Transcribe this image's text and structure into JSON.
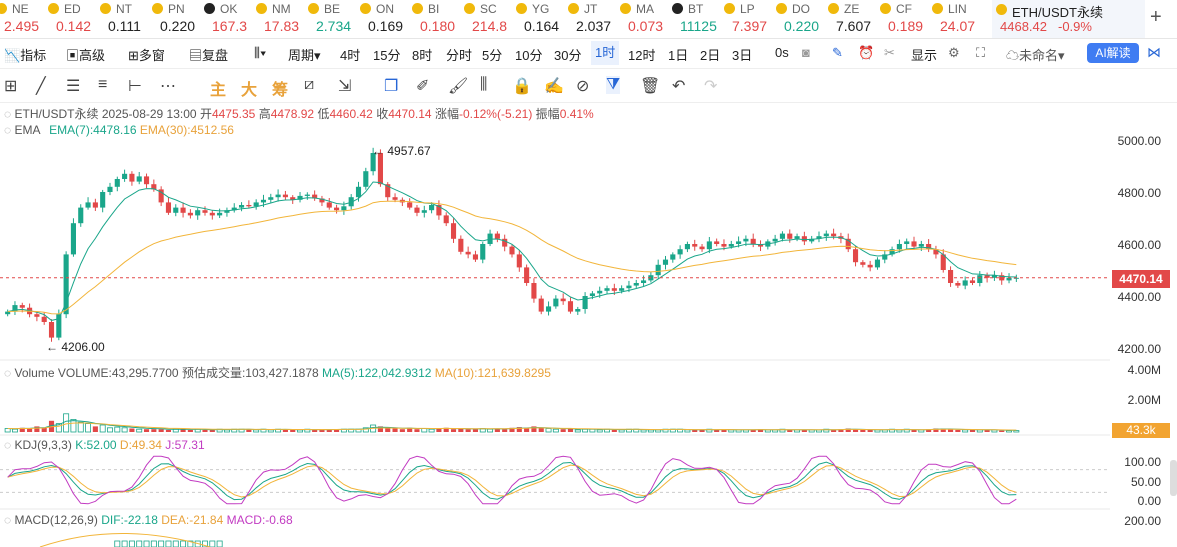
{
  "ticker": [
    {
      "name": "NE",
      "price": "2.495",
      "color": "dn"
    },
    {
      "name": "ED",
      "price": "0.142",
      "color": "dn"
    },
    {
      "name": "NT",
      "price": "0.111",
      "color": "nt"
    },
    {
      "name": "PN",
      "price": "0.220",
      "color": "nt"
    },
    {
      "name": "OK",
      "price": "167.3",
      "color": "dn"
    },
    {
      "name": "NM",
      "price": "17.83",
      "color": "dn"
    },
    {
      "name": "BE",
      "price": "2.734",
      "color": "up"
    },
    {
      "name": "ON",
      "price": "0.169",
      "color": "nt"
    },
    {
      "name": "BI",
      "price": "0.180",
      "color": "dn"
    },
    {
      "name": "SC",
      "price": "214.8",
      "color": "dn"
    },
    {
      "name": "YG",
      "price": "0.164",
      "color": "nt"
    },
    {
      "name": "JT",
      "price": "2.037",
      "color": "nt"
    },
    {
      "name": "MA",
      "price": "0.073",
      "color": "dn"
    },
    {
      "name": "BT",
      "price": "11125",
      "color": "up"
    },
    {
      "name": "LP",
      "price": "7.397",
      "color": "dn"
    },
    {
      "name": "DO",
      "price": "0.220",
      "color": "up"
    },
    {
      "name": "ZE",
      "price": "7.607",
      "color": "nt"
    },
    {
      "name": "CF",
      "price": "0.189",
      "color": "dn"
    },
    {
      "name": "LIN",
      "price": "24.07",
      "color": "dn"
    }
  ],
  "active_tab": {
    "name": "ETH/USDT永续",
    "price": "4468.42",
    "change": "-0.9%"
  },
  "toolbar": {
    "indicators": "指标",
    "advanced": "高级",
    "multi_window": "多窗",
    "replay": "复盘",
    "period": "周期",
    "intervals": [
      "4时",
      "15分",
      "8时",
      "分时",
      "5分",
      "10分",
      "30分",
      "1时",
      "12时",
      "1日",
      "2日",
      "3日"
    ],
    "selected_interval": "1时",
    "seconds": "0s",
    "display": "显示",
    "unnamed": "未命名",
    "ai": "AI解读"
  },
  "draw_tools": {
    "zhu": "主",
    "da": "大",
    "chou": "筹"
  },
  "info": {
    "symbol": "ETH/USDT永续",
    "date": "2025-08-29 13:00",
    "open_label": "开",
    "open": "4475.35",
    "high_label": "高",
    "high": "4478.92",
    "low_label": "低",
    "low": "4460.42",
    "close_label": "收",
    "close": "4470.14",
    "change_label": "涨幅",
    "change": "-0.12%(-5.21)",
    "amp_label": "振幅",
    "amp": "0.41%"
  },
  "ema": {
    "label": "EMA",
    "ema7": "EMA(7):4478.16",
    "ema30": "EMA(30):4512.56"
  },
  "volume": {
    "label": "Volume",
    "vol": "VOLUME:43,295.7700",
    "est": "预估成交量:103,427.1878",
    "ma5": "MA(5):122,042.9312",
    "ma10": "MA(10):121,639.8295",
    "tag": "43.3k",
    "axis": [
      "4.00M",
      "2.00M"
    ]
  },
  "kdj": {
    "label": "KDJ(9,3,3)",
    "k": "K:52.00",
    "d": "D:49.34",
    "j": "J:57.31",
    "axis": [
      "100.00",
      "50.00",
      "0.00"
    ]
  },
  "macd": {
    "label": "MACD(12,26,9)",
    "dif": "DIF:-22.18",
    "dea": "DEA:-21.84",
    "macd": "MACD:-0.68",
    "axis": [
      "200.00"
    ]
  },
  "price_axis": [
    "5000.00",
    "4800.00",
    "4600.00",
    "4400.00",
    "4200.00"
  ],
  "current_price": "4470.14",
  "marks": {
    "high": "4957.67",
    "low": "4206.00"
  },
  "chart_data": {
    "type": "candlestick",
    "symbol": "ETH/USDT永续",
    "interval": "1时",
    "ylim": [
      4200,
      5000
    ],
    "last": {
      "open": 4475.35,
      "high": 4478.92,
      "low": 4460.42,
      "close": 4470.14
    },
    "max": 4957.67,
    "min": 4206.0,
    "closes": [
      4340,
      4365,
      4355,
      4330,
      4320,
      4300,
      4240,
      4330,
      4560,
      4680,
      4740,
      4760,
      4740,
      4800,
      4820,
      4850,
      4870,
      4840,
      4860,
      4830,
      4810,
      4760,
      4720,
      4740,
      4720,
      4710,
      4730,
      4720,
      4710,
      4720,
      4730,
      4740,
      4750,
      4745,
      4760,
      4770,
      4780,
      4790,
      4780,
      4770,
      4785,
      4790,
      4775,
      4760,
      4740,
      4730,
      4745,
      4780,
      4820,
      4880,
      4950,
      4830,
      4780,
      4770,
      4760,
      4740,
      4720,
      4730,
      4750,
      4710,
      4680,
      4620,
      4570,
      4560,
      4540,
      4600,
      4640,
      4620,
      4590,
      4560,
      4510,
      4450,
      4390,
      4340,
      4360,
      4390,
      4380,
      4340,
      4350,
      4400,
      4410,
      4420,
      4430,
      4420,
      4430,
      4440,
      4450,
      4460,
      4480,
      4520,
      4540,
      4560,
      4580,
      4600,
      4590,
      4580,
      4610,
      4600,
      4590,
      4600,
      4610,
      4620,
      4600,
      4590,
      4610,
      4620,
      4640,
      4620,
      4630,
      4610,
      4620,
      4630,
      4640,
      4630,
      4620,
      4580,
      4530,
      4520,
      4510,
      4540,
      4560,
      4580,
      4600,
      4610,
      4590,
      4600,
      4580,
      4560,
      4500,
      4450,
      4440,
      4460,
      4450,
      4480,
      4470,
      4480,
      4460,
      4470,
      4470
    ],
    "volumes": [
      0.25,
      0.2,
      0.3,
      0.25,
      0.4,
      0.3,
      0.8,
      0.6,
      1.3,
      0.9,
      0.7,
      0.6,
      0.4,
      0.5,
      0.3,
      0.35,
      0.3,
      0.25,
      0.2,
      0.2,
      0.2,
      0.2,
      0.15,
      0.2,
      0.2,
      0.15,
      0.2,
      0.15,
      0.15,
      0.2,
      0.15,
      0.2,
      0.2,
      0.2,
      0.15,
      0.2,
      0.15,
      0.2,
      0.2,
      0.15,
      0.15,
      0.2,
      0.15,
      0.2,
      0.15,
      0.2,
      0.2,
      0.2,
      0.2,
      0.3,
      0.5,
      0.4,
      0.3,
      0.25,
      0.2,
      0.3,
      0.2,
      0.25,
      0.2,
      0.25,
      0.3,
      0.2,
      0.25,
      0.2,
      0.2,
      0.25,
      0.2,
      0.25,
      0.2,
      0.3,
      0.35,
      0.3,
      0.4,
      0.3,
      0.25,
      0.2,
      0.2,
      0.25,
      0.15,
      0.2,
      0.2,
      0.15,
      0.2,
      0.15,
      0.15,
      0.2,
      0.2,
      0.15,
      0.15,
      0.15,
      0.2,
      0.2,
      0.2,
      0.15,
      0.15,
      0.15,
      0.2,
      0.15,
      0.2,
      0.15,
      0.15,
      0.15,
      0.15,
      0.2,
      0.15,
      0.15,
      0.2,
      0.15,
      0.15,
      0.15,
      0.15,
      0.15,
      0.2,
      0.15,
      0.2,
      0.25,
      0.2,
      0.15,
      0.15,
      0.15,
      0.15,
      0.2,
      0.15,
      0.2,
      0.15,
      0.15,
      0.2,
      0.25,
      0.25,
      0.2,
      0.15,
      0.15,
      0.15,
      0.15,
      0.15,
      0.15,
      0.1,
      0.1,
      0.1
    ]
  }
}
